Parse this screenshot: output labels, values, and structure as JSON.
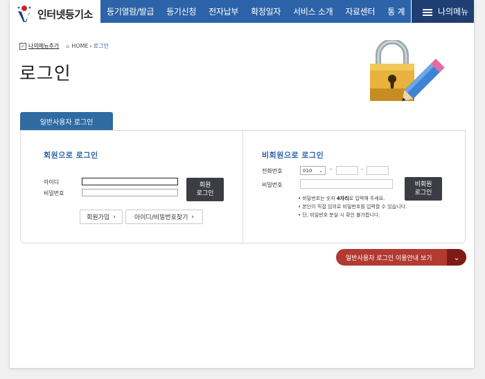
{
  "header": {
    "logo_text": "인터넷등기소",
    "nav": [
      "등기열람/발급",
      "등기신청",
      "전자납부",
      "확정일자",
      "서비스 소개",
      "자료센터",
      "통 계"
    ],
    "my_menu": "나의메뉴"
  },
  "breadcrumb": {
    "add_label": "나의메뉴추가",
    "home": "HOME",
    "current": "로그인"
  },
  "page_title": "로그인",
  "tab_label": "일반사용자 로그인",
  "member": {
    "title": "회원으로 로그인",
    "id_label": "아이디",
    "pw_label": "비밀번호",
    "login_btn_l1": "회원",
    "login_btn_l2": "로그인",
    "join_btn": "회원가입",
    "find_btn": "아이디/비밀번호찾기"
  },
  "nonmember": {
    "title": "비회원으로 로그인",
    "phone_label": "전화번호",
    "phone_prefix": "010",
    "pw_label": "비밀번호",
    "login_btn_l1": "비회원",
    "login_btn_l2": "로그인",
    "note1_a": "비밀번호는 숫자 ",
    "note1_b": "4자리",
    "note1_c": "로 입력해 주세요.",
    "note2": "본인이 직접 임의로 비밀번호를 입력할 수 있습니다.",
    "note3": "단, 비밀번호 분실 시 확인 불가합니다."
  },
  "guide_btn": "일반사용자 로그인 이용안내 보기",
  "colors": {
    "nav": "#2d63a8",
    "my_menu": "#1f3f73",
    "tab": "#2f6aa3",
    "guide": "#b23a31",
    "guide_dark": "#7e1b16"
  },
  "icons": [
    "checkbox-icon",
    "home-icon",
    "chevron-right-icon",
    "chevron-down-icon",
    "padlock-pencil-illustration",
    "hamburger-icon"
  ]
}
